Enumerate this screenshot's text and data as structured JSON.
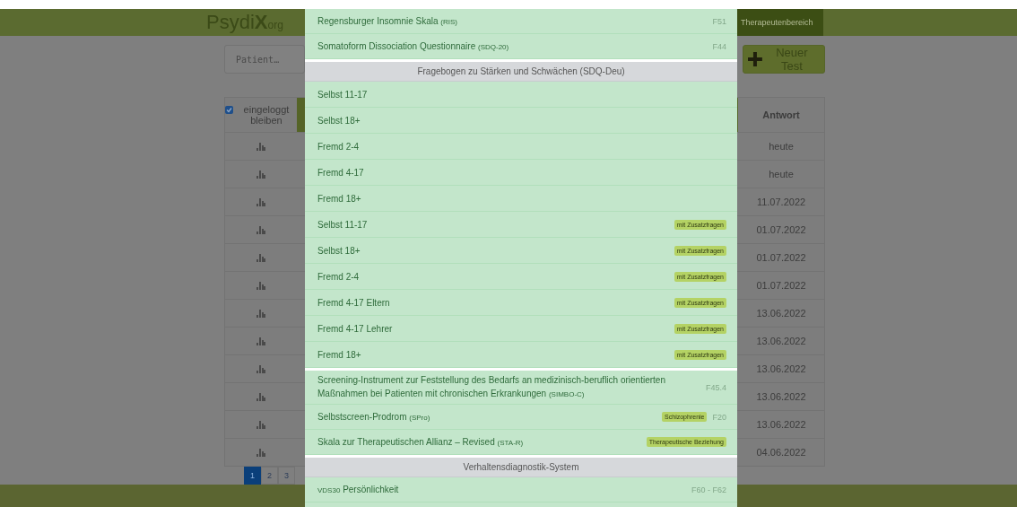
{
  "header": {
    "logo": {
      "name": "Psydi**X**",
      "suffix": "org"
    },
    "button": "Therapeutenbereich"
  },
  "toolbar": {
    "patient_field": {
      "placeholder": "Patient…"
    },
    "new_test_button": "Neuer Test"
  },
  "table": {
    "keep_logged_in": {
      "label": "eingeloggt bleiben",
      "checked": true
    },
    "answer_header": "Antwort",
    "rows": [
      {
        "answer": "heute"
      },
      {
        "answer": "heute"
      },
      {
        "answer": "11.07.2022"
      },
      {
        "answer": "01.07.2022"
      },
      {
        "answer": "01.07.2022"
      },
      {
        "answer": "01.07.2022"
      },
      {
        "answer": "13.06.2022"
      },
      {
        "answer": "13.06.2022"
      },
      {
        "answer": "13.06.2022"
      },
      {
        "answer": "13.06.2022"
      },
      {
        "answer": "13.06.2022"
      },
      {
        "answer": "04.06.2022"
      }
    ]
  },
  "pagination": [
    {
      "label": "1",
      "selected": true
    },
    {
      "label": "2",
      "selected": false
    },
    {
      "label": "3",
      "selected": false
    }
  ],
  "test_list": {
    "groups": [
      {
        "items": [
          {
            "name": "Regensburger Insomnie Skala",
            "abbr": "(RIS)",
            "code": "F51"
          },
          {
            "name": "Somatoform Dissociation Questionnaire",
            "abbr": "(SDQ-20)",
            "code": "F44"
          }
        ]
      },
      {
        "header": "Fragebogen zu Stärken und Schwächen (SDQ-Deu)",
        "items": [
          {
            "name": "Selbst 11-17"
          },
          {
            "name": "Selbst 18+"
          },
          {
            "name": "Fremd 2-4"
          },
          {
            "name": "Fremd 4-17"
          },
          {
            "name": "Fremd 18+"
          },
          {
            "name": "Selbst 11-17",
            "badge": "mit Zusatzfragen"
          },
          {
            "name": "Selbst 18+",
            "badge": "mit Zusatzfragen"
          },
          {
            "name": "Fremd 2-4",
            "badge": "mit Zusatzfragen"
          },
          {
            "name": "Fremd 4-17 Eltern",
            "badge": "mit Zusatzfragen"
          },
          {
            "name": "Fremd 4-17 Lehrer",
            "badge": "mit Zusatzfragen"
          },
          {
            "name": "Fremd 18+",
            "badge": "mit Zusatzfragen"
          }
        ]
      },
      {
        "items": [
          {
            "name": "Screening-Instrument zur Feststellung des Bedarfs an medizinisch-beruflich orientierten Maßnahmen bei Patienten mit chronischen Erkrankungen",
            "abbr": "(SIMBO-C)",
            "code": "F45.4"
          },
          {
            "name": "Selbstscreen-Prodrom",
            "abbr": "(SPro)",
            "badge": "Schizophrenie",
            "code": "F20"
          },
          {
            "name": "Skala zur Therapeutischen Allianz – Revised",
            "abbr": "(STA-R)",
            "badge": "Therapeutische Beziehung"
          }
        ]
      },
      {
        "header": "Verhaltensdiagnostik-System",
        "items": [
          {
            "prefix": "VDS30",
            "name": "Persönlichkeit",
            "code": "F60 - F62"
          }
        ]
      }
    ]
  }
}
